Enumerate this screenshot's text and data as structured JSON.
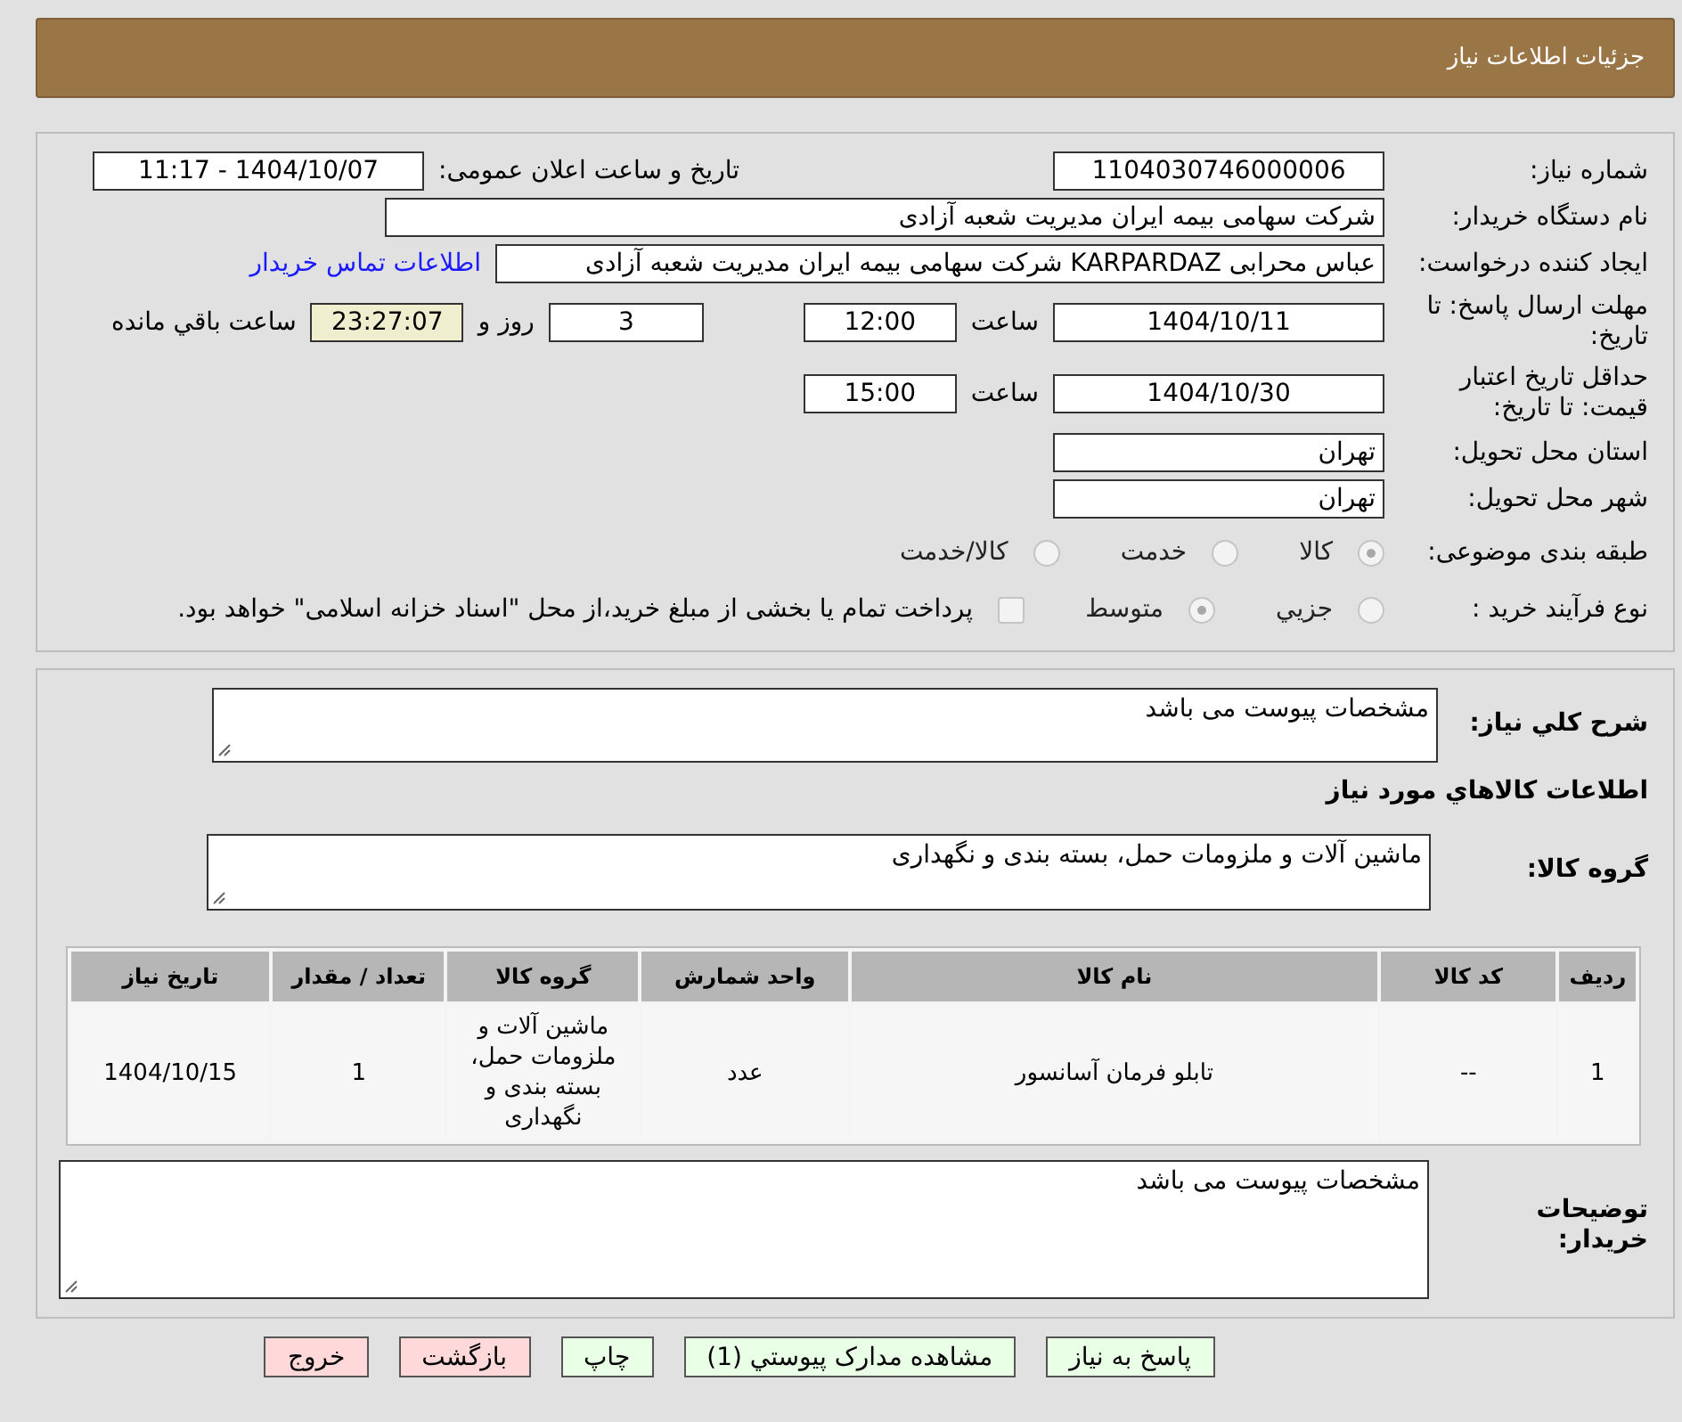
{
  "header": {
    "title": "جزئیات اطلاعات نیاز"
  },
  "details": {
    "need_number": {
      "label": "شماره نیاز:",
      "value": "1104030746000006"
    },
    "announce": {
      "label": "تاریخ و ساعت اعلان عمومی:",
      "value": "1404/10/07 - 11:17"
    },
    "buyer": {
      "label": "نام دستگاه خریدار:",
      "value": "شرکت سهامی بیمه ایران مدیریت شعبه آزادی"
    },
    "creator": {
      "label": "ایجاد کننده درخواست:",
      "value": "عباس محرابی KARPARDAZ شرکت سهامی بیمه ایران مدیریت شعبه آزادی",
      "link": "اطلاعات تماس خریدار"
    },
    "deadline": {
      "label": "مهلت ارسال پاسخ: تا تاریخ:",
      "date": "1404/10/11",
      "time_label": "ساعت",
      "time": "12:00",
      "days": "3",
      "days_label": "روز و",
      "remaining": "23:27:07",
      "remaining_label": "ساعت باقي مانده"
    },
    "validity": {
      "label": "حداقل تاریخ اعتبار قیمت: تا تاریخ:",
      "date": "1404/10/30",
      "time_label": "ساعت",
      "time": "15:00"
    },
    "province": {
      "label": "استان محل تحویل:",
      "value": "تهران"
    },
    "city": {
      "label": "شهر محل تحویل:",
      "value": "تهران"
    },
    "category": {
      "label": "طبقه بندی موضوعی:",
      "options": [
        {
          "label": "کالا",
          "selected": true
        },
        {
          "label": "خدمت",
          "selected": false
        },
        {
          "label": "کالا/خدمت",
          "selected": false
        }
      ]
    },
    "process": {
      "label": "نوع فرآیند خرید :",
      "options": [
        {
          "label": "جزيي",
          "selected": false
        },
        {
          "label": "متوسط",
          "selected": true
        }
      ],
      "payment": {
        "checked": false,
        "label": "پرداخت تمام یا بخشی از مبلغ خرید،از محل \"اسناد خزانه اسلامی\" خواهد بود."
      }
    }
  },
  "goods": {
    "description": {
      "label": "شرح کلي نیاز:",
      "value": "مشخصات پیوست می باشد"
    },
    "heading": "اطلاعات کالاهاي مورد نیاز",
    "group": {
      "label": "گروه کالا:",
      "value": "ماشین آلات و ملزومات حمل، بسته بندی و نگهداری"
    },
    "table": {
      "columns": [
        "ردیف",
        "کد کالا",
        "نام کالا",
        "واحد شمارش",
        "گروه کالا",
        "تعداد / مقدار",
        "تاریخ نیاز"
      ],
      "rows": [
        [
          "1",
          "--",
          "تابلو فرمان آسانسور",
          "عدد",
          "ماشین آلات و ملزومات حمل، بسته بندی و نگهداری",
          "1",
          "1404/10/15"
        ]
      ]
    },
    "notes": {
      "label": "توضیحات خریدار:",
      "value": "مشخصات پیوست می باشد"
    }
  },
  "buttons": [
    {
      "label": "پاسخ به نیاز",
      "kind": "normal"
    },
    {
      "label": "مشاهده مدارک پیوستي (1)",
      "kind": "normal"
    },
    {
      "label": "چاپ",
      "kind": "normal"
    },
    {
      "label": "بازگشت",
      "kind": "danger"
    },
    {
      "label": "خروج",
      "kind": "danger"
    }
  ]
}
